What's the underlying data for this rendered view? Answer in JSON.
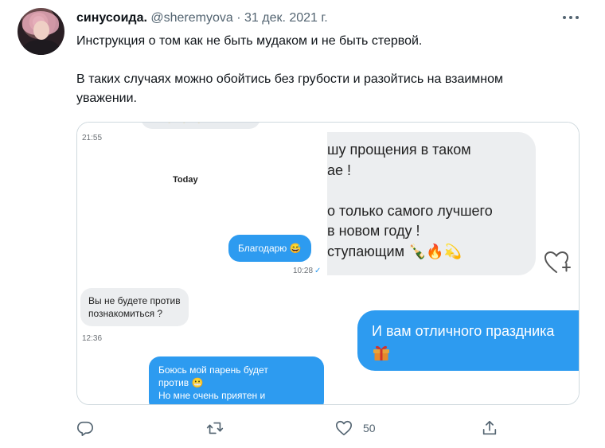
{
  "author": {
    "name": "синусоида.",
    "handle": "@sheremyova",
    "separator": "·",
    "date": "31 дек. 2021 г."
  },
  "tweet": {
    "line1": "Инструкция о том как не быть мудаком и не быть стервой.",
    "line2": "В таких случаях можно обойтись без грубости и разойтись на взаимном",
    "line3": "уважении."
  },
  "screenshot_left": {
    "time_top": "21:55",
    "day_divider": "Today",
    "reply_thanks": "Благодарю 😅",
    "reply_thanks_time": "10:28",
    "read_check": "✓",
    "question_line1": "Вы не будете против",
    "question_line2": "познакомиться ?",
    "question_time": "12:36",
    "answer_line1": "Боюсь мой парень будет",
    "answer_line2": "против 😬",
    "answer_line3": "Но мне очень приятен и"
  },
  "screenshot_right": {
    "line1": "шу прощения в таком",
    "line2": "ае !",
    "line3": "о только самого лучшего",
    "line4": "в новом году !",
    "line5": "ступающим 🍾🔥💫",
    "blue_text": "И вам отличного праздника"
  },
  "actions": {
    "like_count": "50"
  },
  "icons": [
    "more-icon",
    "reply-icon",
    "retweet-icon",
    "like-icon",
    "share-icon",
    "heart-plus-icon",
    "gift-icon"
  ],
  "colors": {
    "text": "#0f1419",
    "muted": "#536471",
    "border": "#cfd9de",
    "bubble_blue": "#2d9bf0",
    "bubble_gray": "#eceef0"
  }
}
